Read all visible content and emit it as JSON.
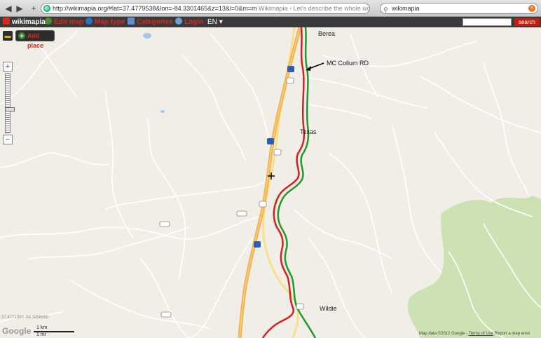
{
  "browser": {
    "url": "http://wikimapia.org/#lat=37.4779538&lon=-84.3301465&z=13&l=0&m=m",
    "page_title": "Wikimapia - Let's describe the whole world!",
    "search_value": "wikimapia"
  },
  "toolbar": {
    "logo": "wikimapia",
    "edit_map": "Edit map",
    "map_type": "Map type",
    "categories": "Categories",
    "login": "Login",
    "language": "EN"
  },
  "controls": {
    "add_place": "Add place",
    "zoom_in": "+",
    "zoom_out": "−"
  },
  "map": {
    "places": {
      "berea": "Berea",
      "texas": "Texas",
      "wildie": "Wildie"
    },
    "annotation": "MC Collum RD",
    "coords": "37.4771300 -84.3456650",
    "scale_label_km": "1 km",
    "scale_label_mi": "1 mi",
    "google": "Google",
    "attribution_prefix": "Map data ©2012 Google - ",
    "terms_link": "Terms of Use",
    "attribution_suffix": " Report a map error"
  },
  "colors": {
    "accent": "#d8281c",
    "interstate": "#f2b04b",
    "highlight_red": "#d42020",
    "highlight_green": "#1e9a2a",
    "forest": "#cde2b2"
  }
}
